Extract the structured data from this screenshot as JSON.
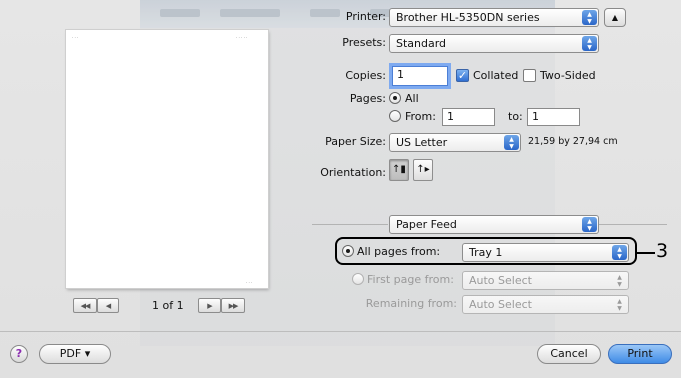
{
  "printer": {
    "label": "Printer:",
    "value": "Brother HL-5350DN series"
  },
  "presets": {
    "label": "Presets:",
    "value": "Standard"
  },
  "copies": {
    "label": "Copies:",
    "value": "1",
    "collated_label": "Collated",
    "collated": true,
    "two_sided_label": "Two-Sided",
    "two_sided": false
  },
  "pages": {
    "label": "Pages:",
    "all_label": "All",
    "from_label": "From:",
    "from_value": "1",
    "to_label": "to:",
    "to_value": "1",
    "selected": "all"
  },
  "paper_size": {
    "label": "Paper Size:",
    "value": "US Letter",
    "dimensions": "21,59 by 27,94 cm"
  },
  "orientation": {
    "label": "Orientation:",
    "selected": "portrait"
  },
  "panel": {
    "value": "Paper Feed"
  },
  "paper_feed": {
    "all_pages_label": "All pages from:",
    "all_pages_value": "Tray 1",
    "first_page_label": "First page from:",
    "first_page_value": "Auto Select",
    "remaining_label": "Remaining from:",
    "remaining_value": "Auto Select",
    "selected": "all_pages"
  },
  "preview": {
    "page_indicator": "1 of 1"
  },
  "buttons": {
    "help": "?",
    "pdf": "PDF ▾",
    "cancel": "Cancel",
    "print": "Print"
  },
  "callout": {
    "number": "3"
  },
  "icons": {
    "popup_arrows": "updown-arrows-icon",
    "collapse": "triangle-up-icon",
    "portrait": "portrait-orientation-icon",
    "landscape": "landscape-orientation-icon"
  },
  "colors": {
    "accent": "#3f8be6",
    "focus_ring": "#7eaaf0",
    "callout": "#000000"
  }
}
